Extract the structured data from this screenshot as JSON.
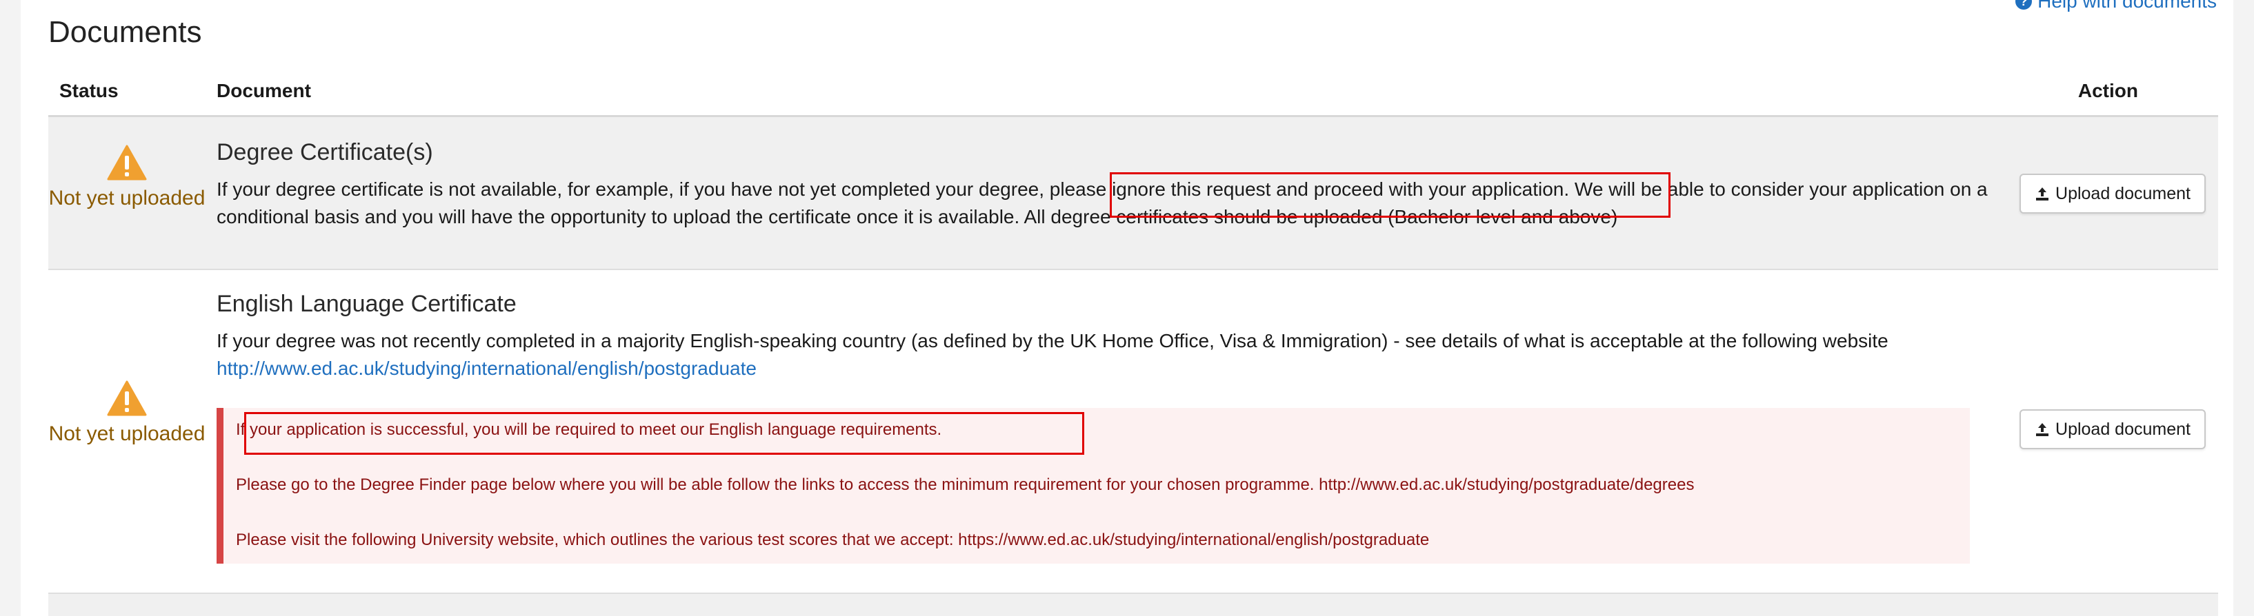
{
  "section": {
    "title": "Documents",
    "help_link": "Help with documents"
  },
  "table": {
    "headers": {
      "status": "Status",
      "document": "Document",
      "action": "Action"
    },
    "rows": [
      {
        "status": "Not yet uploaded",
        "title": "Degree Certificate(s)",
        "description": "If your degree certificate is not available, for example, if you have not yet completed your degree, please ignore this request and proceed with your application. We will be able to consider your application on a conditional basis and you will have the opportunity to upload the certificate once it is available. All degree certificates should be uploaded (Bachelor level and above)",
        "action": "Upload document"
      },
      {
        "status": "Not yet uploaded",
        "title": "English Language Certificate",
        "description": "If your degree was not recently completed in a majority English-speaking country (as defined by the UK Home Office, Visa & Immigration) - see details of what is acceptable at the following website",
        "link": "http://www.ed.ac.uk/studying/international/english/postgraduate",
        "alert_lines": [
          "If your application is successful, you will be required to meet our English language requirements.",
          "Please go to the Degree Finder page below where you will be able follow the links to access the minimum requirement for your chosen programme. http://www.ed.ac.uk/studying/postgraduate/degrees",
          "Please visit the following University website, which outlines the various test scores that we accept: https://www.ed.ac.uk/studying/international/english/postgraduate"
        ],
        "action": "Upload document"
      }
    ]
  },
  "icons": {
    "status": "warning-icon",
    "upload": "upload-icon",
    "help": "question-circle-icon"
  },
  "colors": {
    "link": "#1f6fbf",
    "warning": "#f0a030",
    "status_text": "#8a5a00",
    "alert_text": "#8a1212",
    "alert_bg": "#fdf1f1",
    "alert_border": "#d64545",
    "highlight": "#e00000"
  }
}
